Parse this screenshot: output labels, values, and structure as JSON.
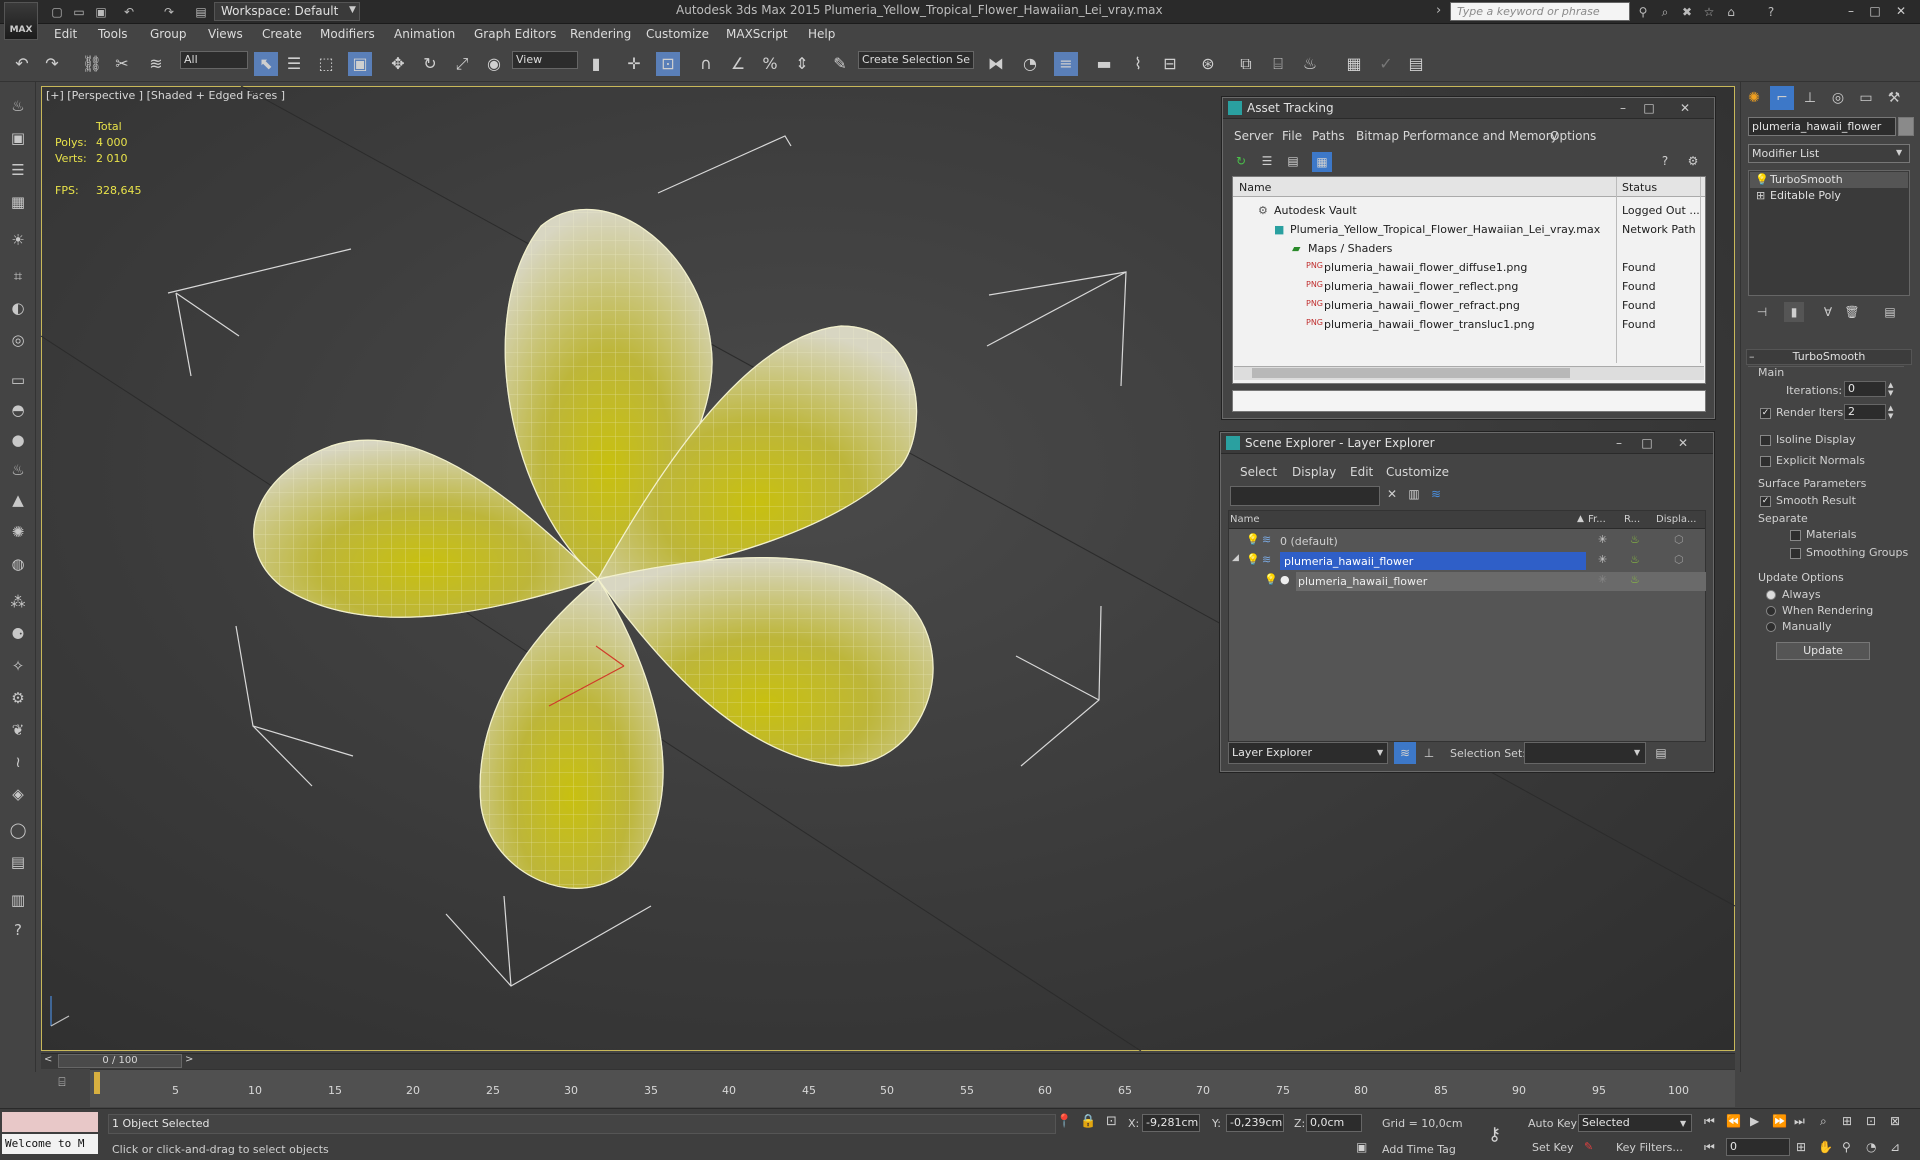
{
  "titlebar": {
    "logo_text": "MAX",
    "workspace": "Workspace: Default",
    "app_title": "Autodesk 3ds Max 2015    Plumeria_Yellow_Tropical_Flower_Hawaiian_Lei_vray.max",
    "search_placeholder": "Type a keyword or phrase"
  },
  "menu": [
    "Edit",
    "Tools",
    "Group",
    "Views",
    "Create",
    "Modifiers",
    "Animation",
    "Graph Editors",
    "Rendering",
    "Customize",
    "MAXScript",
    "Help"
  ],
  "toolbar": {
    "selection_filter": "All",
    "ref_coord": "View",
    "named_selection": "Create Selection Se"
  },
  "viewport": {
    "label": "[+] [Perspective ] [Shaded + Edged Faces ]",
    "stats_header": "Total",
    "polys_label": "Polys:",
    "polys_value": "4 000",
    "verts_label": "Verts:",
    "verts_value": "2 010",
    "fps_label": "FPS:",
    "fps_value": "328,645"
  },
  "asset_tracking": {
    "title": "Asset Tracking",
    "menu": [
      "Server",
      "File",
      "Paths",
      "Bitmap Performance and Memory",
      "Options"
    ],
    "columns": [
      "Name",
      "Status"
    ],
    "rows": [
      {
        "name": "Autodesk Vault",
        "status": "Logged Out ..."
      },
      {
        "name": "Plumeria_Yellow_Tropical_Flower_Hawaiian_Lei_vray.max",
        "status": "Network Path"
      },
      {
        "name": "Maps / Shaders",
        "status": ""
      },
      {
        "name": "plumeria_hawaii_flower_diffuse1.png",
        "status": "Found"
      },
      {
        "name": "plumeria_hawaii_flower_reflect.png",
        "status": "Found"
      },
      {
        "name": "plumeria_hawaii_flower_refract.png",
        "status": "Found"
      },
      {
        "name": "plumeria_hawaii_flower_transluc1.png",
        "status": "Found"
      }
    ]
  },
  "scene_explorer": {
    "title": "Scene Explorer - Layer Explorer",
    "menu": [
      "Select",
      "Display",
      "Edit",
      "Customize"
    ],
    "columns": [
      "Name",
      "Fr...",
      "R...",
      "Displa..."
    ],
    "rows": [
      {
        "name": "0 (default)"
      },
      {
        "name": "plumeria_hawaii_flower"
      },
      {
        "name": "plumeria_hawaii_flower"
      }
    ],
    "footer_mode": "Layer Explorer",
    "selection_set_label": "Selection Set:"
  },
  "command_panel": {
    "object_name": "plumeria_hawaii_flower",
    "modifier_list": "Modifier List",
    "stack": [
      "TurboSmooth",
      "Editable Poly"
    ],
    "rollout_title": "TurboSmooth",
    "main_label": "Main",
    "iterations_label": "Iterations:",
    "iterations_value": "0",
    "render_iters_label": "Render Iters:",
    "render_iters_value": "2",
    "isoline_label": "Isoline Display",
    "explicit_normals_label": "Explicit Normals",
    "surface_params_label": "Surface Parameters",
    "smooth_result_label": "Smooth Result",
    "separate_label": "Separate",
    "materials_label": "Materials",
    "smoothing_groups_label": "Smoothing Groups",
    "update_options_label": "Update Options",
    "always_label": "Always",
    "when_rendering_label": "When Rendering",
    "manually_label": "Manually",
    "update_button": "Update"
  },
  "timeline": {
    "frame_counter": "0 / 100",
    "ticks": [
      "5",
      "10",
      "15",
      "20",
      "25",
      "30",
      "35",
      "40",
      "45",
      "50",
      "55",
      "60",
      "65",
      "70",
      "75",
      "80",
      "85",
      "90",
      "95",
      "100"
    ]
  },
  "status": {
    "maxscript_output": "Welcome to M",
    "selection_count": "1 Object Selected",
    "prompt": "Click or click-and-drag to select objects",
    "x_label": "X:",
    "x_value": "-9,281cm",
    "y_label": "Y:",
    "y_value": "-0,239cm",
    "z_label": "Z:",
    "z_value": "0,0cm",
    "grid": "Grid = 10,0cm",
    "auto_key": "Auto Key",
    "selected_dd": "Selected",
    "set_key": "Set Key",
    "key_filters": "Key Filters...",
    "add_time_tag": "Add Time Tag",
    "frame_field": "0"
  }
}
